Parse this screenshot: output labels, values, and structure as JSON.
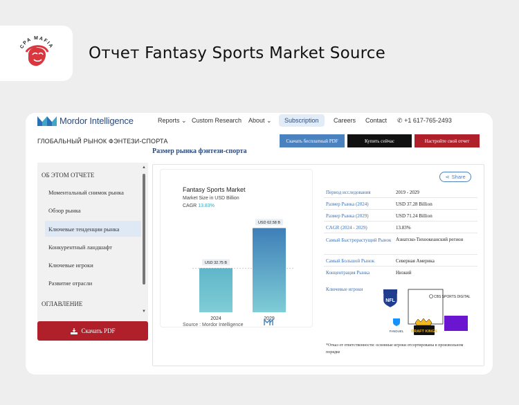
{
  "header": {
    "logo_text": "CPA MAFIA",
    "title": "Отчет Fantasy Sports Market Source"
  },
  "site": {
    "brand": "Mordor Intelligence",
    "nav": [
      {
        "label": "Reports",
        "has_dropdown": true
      },
      {
        "label": "Custom Research",
        "has_dropdown": false
      },
      {
        "label": "About",
        "has_dropdown": true
      },
      {
        "label": "Subscription",
        "has_dropdown": false
      },
      {
        "label": "Careers",
        "has_dropdown": false
      },
      {
        "label": "Contact",
        "has_dropdown": false
      }
    ],
    "phone": "+1 617-765-2493",
    "colors": {
      "accent_blue": "#4a82c0",
      "accent_red": "#b0202a",
      "chart_teal": "#5fb6c9",
      "chart_blue": "#3e7fb8"
    }
  },
  "subbar": {
    "title": "ГЛОБАЛЬНЫЙ РЫНОК ФЭНТЕЗИ-СПОРТА",
    "buttons": [
      "Скачать бесплатный PDF",
      "Купить сейчас",
      "Настройте свой отчет"
    ]
  },
  "section_heading": "Размер рынка фэнтези-спорта",
  "sidebar": {
    "about_title": "ОБ ЭТОМ ОТЧЕТЕ",
    "items": [
      {
        "label": "Моментальный снимок рынка",
        "active": false
      },
      {
        "label": "Обзор рынка",
        "active": false
      },
      {
        "label": "Ключевые тенденции рынка",
        "active": true
      },
      {
        "label": "Конкурентный ландшафт",
        "active": false
      },
      {
        "label": "Ключевые игроки",
        "active": false
      },
      {
        "label": "Развитие отрасли",
        "active": false
      }
    ],
    "toc_title": "ОГЛАВЛЕНИЕ",
    "download_label": "Скачать PDF"
  },
  "chart_data": {
    "type": "bar",
    "title": "Fantasy Sports Market",
    "subtitle": "Market Size in USD Billion",
    "cagr_label": "CAGR",
    "cagr_value": "13.83%",
    "categories": [
      "2024",
      "2029"
    ],
    "values": [
      32.75,
      62.58
    ],
    "value_labels": [
      "USD 32.75 B",
      "USD 62.58 B"
    ],
    "ylim": [
      0,
      70
    ],
    "grid": false,
    "source": "Source : Mordor Intelligence"
  },
  "share_label": "Share",
  "facts": [
    {
      "key": "Период исследования",
      "value": "2019 - 2029"
    },
    {
      "key": "Размер Рынка (2024)",
      "value": "USD 37.28 Billion"
    },
    {
      "key": "Размер Рынка (2029)",
      "value": "USD 71.24 Billion"
    },
    {
      "key": "CAGR (2024 - 2029)",
      "value": "13.83%"
    },
    {
      "key": "Самый Быстрорастущий Рынок",
      "value": "Азиатско-Тихоокеанский регион"
    },
    {
      "key": "Самый Большой Рынок",
      "value": "Северная Америка"
    },
    {
      "key": "Концентрация Рынка",
      "value": "Низкий"
    }
  ],
  "key_players": {
    "label": "Ключевые игроки",
    "logos": [
      "NFL",
      "CBS SPORTS DIGITAL",
      "FANDUEL",
      "DRAFT KINGS"
    ]
  },
  "disclaimer": "*Отказ от ответственности: основные игроки отсортированы в произвольном порядке"
}
